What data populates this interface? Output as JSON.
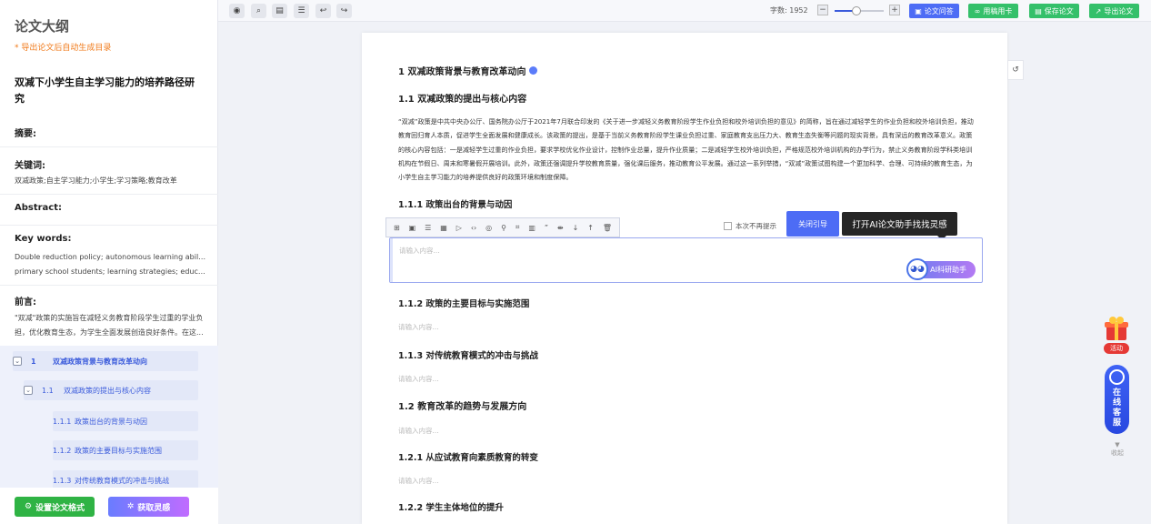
{
  "sidebar": {
    "title": "论文大纲",
    "hint": "* 导出论文后自动生成目录",
    "doc_title": "双减下小学生自主学习能力的培养路径研究",
    "abstract_label": "摘要:",
    "keywords_label": "关键词:",
    "keywords_text": "双减政策;自主学习能力;小学生;学习策略;教育改革",
    "abstract_en_label": "Abstract:",
    "keywords_en_label": "Key words:",
    "keywords_en_line1": "Double reduction policy; autonomous learning ability;",
    "keywords_en_line2": "primary school students; learning strategies; education...",
    "preface_label": "前言:",
    "preface_line1": "\"双减\"政策的实施旨在减轻义务教育阶段学生过重的学业负",
    "preface_line2": "担，优化教育生态，为学生全面发展创造良好条件。在这...",
    "toc": [
      {
        "num": "1",
        "label": "双减政策背景与教育改革动向"
      },
      {
        "num": "1.1",
        "label": "双减政策的提出与核心内容"
      },
      {
        "num": "1.1.1",
        "label": "政策出台的背景与动因"
      },
      {
        "num": "1.1.2",
        "label": "政策的主要目标与实施范围"
      },
      {
        "num": "1.1.3",
        "label": "对传统教育模式的冲击与挑战"
      }
    ],
    "btn_format": "设置论文格式",
    "btn_inspire": "获取灵感"
  },
  "toolbar": {
    "icons": [
      "eye-icon",
      "search-doc-icon",
      "save-icon",
      "list-icon",
      "undo-icon",
      "redo-icon"
    ],
    "word_count_label": "字数: 1952",
    "zoom_level": 0.45,
    "buttons": [
      {
        "label": "论文问答",
        "color": "#4d6cf5"
      },
      {
        "label": "用稿用卡",
        "color": "#34c06a"
      },
      {
        "label": "保存论文",
        "color": "#34c06a"
      },
      {
        "label": "导出论文",
        "color": "#34c06a"
      }
    ]
  },
  "doc": {
    "h1": "1 双减政策背景与教育改革动向",
    "h2_1": "1.1 双减政策的提出与核心内容",
    "para": "“双减”政策是中共中央办公厅、国务院办公厅于2021年7月联合印发的《关于进一步减轻义务教育阶段学生作业负担和校外培训负担的意见》的简称，旨在通过减轻学生的作业负担和校外培训负担，推动教育回归育人本质，促进学生全面发展和健康成长。该政策的提出，是基于当前义务教育阶段学生课业负担过重、家庭教育支出压力大、教育生态失衡等问题的现实背景，具有深远的教育改革意义。政策的核心内容包括：一是减轻学生过重的作业负担，要求学校优化作业设计，控制作业总量，提升作业质量；二是减轻学生校外培训负担，严格规范校外培训机构的办学行为，禁止义务教育阶段学科类培训机构在节假日、周末和寒暑假开展培训。此外，政策还强调提升学校教育质量，强化课后服务，推动教育公平发展。通过这一系列举措，“双减”政策试图构建一个更加科学、合理、可持续的教育生态，为小学生自主学习能力的培养提供良好的政策环境和制度保障。",
    "h3_1": "1.1.1 政策出台的背景与动因",
    "editor_icons": [
      "⊞",
      "▣",
      "☰",
      "▦",
      "▷",
      "</>",
      "◎",
      "⚲",
      "⌗",
      "▥",
      "”",
      "⇼",
      "↓",
      "↑",
      "🗑"
    ],
    "no_more_tip": "本次不再提示",
    "close_guide": "关闭引导",
    "tip_text": "打开AI论文助手找找灵感",
    "editor_placeholder": "请输入内容...",
    "ai_button": "AI科研助手",
    "h3_2": "1.1.2 政策的主要目标与实施范围",
    "h3_3": "1.1.3 对传统教育模式的冲击与挑战",
    "h2_2": "1.2 教育改革的趋势与发展方向",
    "h3_4": "1.2.1 从应试教育向素质教育的转变",
    "h3_5": "1.2.2 学生主体地位的提升",
    "placeholder": "请输入内容..."
  },
  "float": {
    "gift_tag": "活动",
    "service_label": "在线客服",
    "collapse_label": "收起"
  }
}
